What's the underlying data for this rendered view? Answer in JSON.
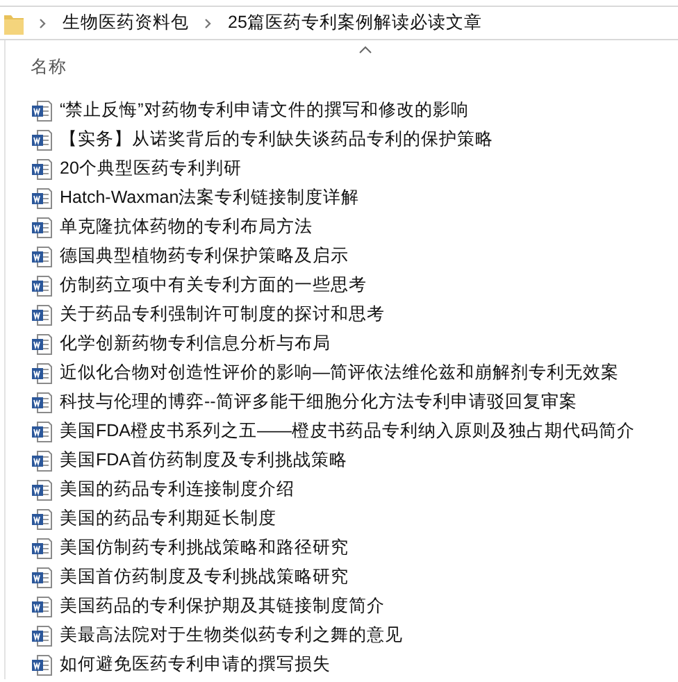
{
  "breadcrumb": [
    "生物医药资料包",
    "25篇医药专利案例解读必读文章"
  ],
  "column": {
    "label": "名称",
    "sort_ascending": true
  },
  "files": [
    {
      "name": "“禁止反悔”对药物专利申请文件的撰写和修改的影响"
    },
    {
      "name": "【实务】从诺奖背后的专利缺失谈药品专利的保护策略"
    },
    {
      "name": "20个典型医药专利判研"
    },
    {
      "name": "Hatch-Waxman法案专利链接制度详解"
    },
    {
      "name": "单克隆抗体药物的专利布局方法"
    },
    {
      "name": "德国典型植物药专利保护策略及启示"
    },
    {
      "name": "仿制药立项中有关专利方面的一些思考"
    },
    {
      "name": "关于药品专利强制许可制度的探讨和思考"
    },
    {
      "name": "化学创新药物专利信息分析与布局"
    },
    {
      "name": "近似化合物对创造性评价的影响—简评依法维伦兹和崩解剂专利无效案"
    },
    {
      "name": "科技与伦理的博弈--简评多能干细胞分化方法专利申请驳回复审案"
    },
    {
      "name": "美国FDA橙皮书系列之五——橙皮书药品专利纳入原则及独占期代码简介"
    },
    {
      "name": "美国FDA首仿药制度及专利挑战策略"
    },
    {
      "name": "美国的药品专利连接制度介绍"
    },
    {
      "name": "美国的药品专利期延长制度"
    },
    {
      "name": "美国仿制药专利挑战策略和路径研究"
    },
    {
      "name": "美国首仿药制度及专利挑战策略研究"
    },
    {
      "name": "美国药品的专利保护期及其链接制度简介"
    },
    {
      "name": "美最高法院对于生物类似药专利之舞的意见"
    },
    {
      "name": "如何避免医药专利申请的撰写损失"
    }
  ]
}
